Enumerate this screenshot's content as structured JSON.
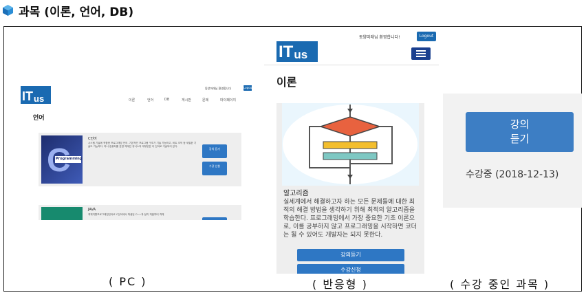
{
  "heading": "과목 (이론, 언어, DB)",
  "pc": {
    "logo_main": "IT",
    "logo_sub": "us",
    "welcome": "동양미래님 환영합니다",
    "logout": "Logout",
    "nav": [
      "이론",
      "언어",
      "DB",
      "게시판",
      "문제",
      "마이페이지"
    ],
    "section_heading": "언어",
    "card1": {
      "image_text": "Programming",
      "title": "C언어",
      "desc": "시스템 기술에 적합한 프로그래밍 언어. 기본적인 프로그램 구조가 기술 가능하고, 비트 조작 등 세밀한 기술도 가능하다. 하나 컴퓨터를 운영 체계인 유닉스의 대부분은 이 언어로 기술되어 있다.",
      "btn1": "강의 듣기",
      "btn2": "수강 신청"
    },
    "card2": {
      "title": "JAVA",
      "desc": "객체지향프로그래밍언어로 C언어에서 파생된 C++과 달리 처음부터 객체"
    }
  },
  "mobile": {
    "welcome": "동양미래님 환영합니다!",
    "logout": "Logout",
    "logo_main": "IT",
    "logo_sub": "us",
    "section_heading": "이론",
    "card_title": "알고리즘",
    "card_text": "실세계에서 해결하고자 하는 모든 문제들에 대한 최적의 해결 방법을 생각하기 위해 최적의 알고리즘을 학습한다. 프로그래밍에서 가장 중요한 기초 이론으로, 이를 공부하지 않고 프로그래밍을 시작하면 코더는 될 수 있어도 개발자는 되지 못한다.",
    "btn_lecture": "강의듣기",
    "btn_enroll": "수강신청"
  },
  "course": {
    "button_line1": "강의",
    "button_line2": "듣기",
    "status": "수강중 (2018-12-13)"
  },
  "captions": {
    "pc": "( PC )",
    "mobile": "( 반응형 )",
    "course": "( 수강 중인 과목 )"
  },
  "colors": {
    "brand": "#1a6ab1",
    "button": "#2e77c4",
    "course_button": "#3d7ec4"
  }
}
